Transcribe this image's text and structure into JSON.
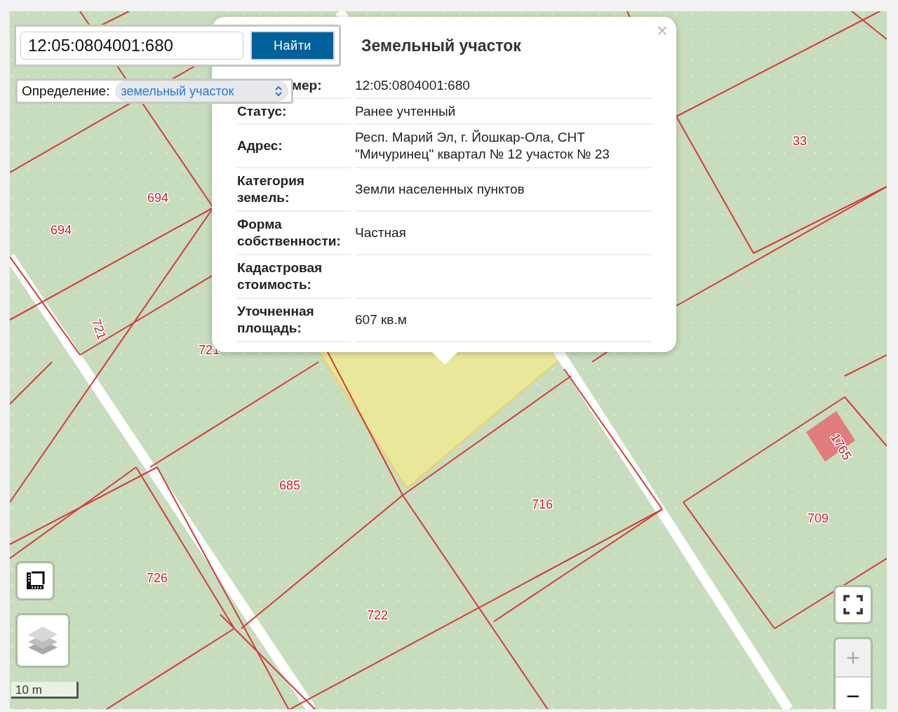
{
  "search": {
    "value": "12:05:0804001:680",
    "button": "Найти"
  },
  "definition": {
    "label": "Определение:",
    "value": "земельный участок"
  },
  "popup": {
    "title": "Земельный участок",
    "close": "×",
    "rows": [
      {
        "label": "мер:",
        "value": "12:05:0804001:680"
      },
      {
        "label": "Статус:",
        "value": "Ранее учтенный"
      },
      {
        "label": "Адрес:",
        "value": "Респ. Марий Эл, г. Йошкар-Ола, СНТ \"Мичуринец\" квартал № 12 участок № 23"
      },
      {
        "label": "Категория земель:",
        "value": "Земли населенных пунктов"
      },
      {
        "label": "Форма собственности:",
        "value": "Частная"
      },
      {
        "label": "Кадастровая стоимость:",
        "value": ""
      },
      {
        "label": "Уточненная площадь:",
        "value": "607 кв.м"
      }
    ]
  },
  "parcels": [
    {
      "label": "694",
      "kind": "plot"
    },
    {
      "label": "694",
      "kind": "plot"
    },
    {
      "label": "721",
      "kind": "plot"
    },
    {
      "label": "721",
      "kind": "plot"
    },
    {
      "label": "33",
      "kind": "plot"
    },
    {
      "label": "685",
      "kind": "plot"
    },
    {
      "label": "716",
      "kind": "plot"
    },
    {
      "label": "709",
      "kind": "plot"
    },
    {
      "label": "726",
      "kind": "plot"
    },
    {
      "label": "722",
      "kind": "plot"
    },
    {
      "label": "1765",
      "kind": "building"
    }
  ],
  "zoom": {
    "plus": "+",
    "minus": "−",
    "plus_disabled": true
  },
  "scale": {
    "label": "10 m"
  }
}
